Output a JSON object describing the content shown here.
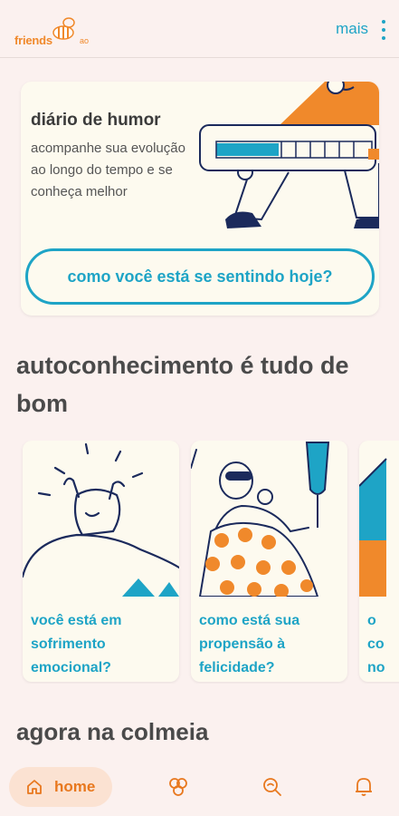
{
  "header": {
    "logo_text": "friends",
    "logo_suffix": "ao",
    "menu_label": "mais"
  },
  "mood_card": {
    "title": "diário de humor",
    "description": "acompanhe sua evolução ao longo do tempo e se conheça melhor",
    "button_label": "como você está se sentindo hoje?",
    "progress_fraction": 0.4
  },
  "self_knowledge": {
    "title": "autoconhecimento é tudo de bom",
    "cards": [
      {
        "label": "você está em sofrimento emocional?"
      },
      {
        "label": "como está sua propensão à felicidade?"
      },
      {
        "label": "o co no"
      }
    ]
  },
  "hive": {
    "title": "agora na colmeia"
  },
  "bottom_nav": {
    "home_label": "home",
    "items": [
      "home-icon",
      "hive-icon",
      "search-icon",
      "bell-icon"
    ]
  },
  "colors": {
    "accent_blue": "#1ea4c6",
    "accent_orange": "#f0892b",
    "background": "#fbf1ef",
    "card": "#fdfaef"
  }
}
